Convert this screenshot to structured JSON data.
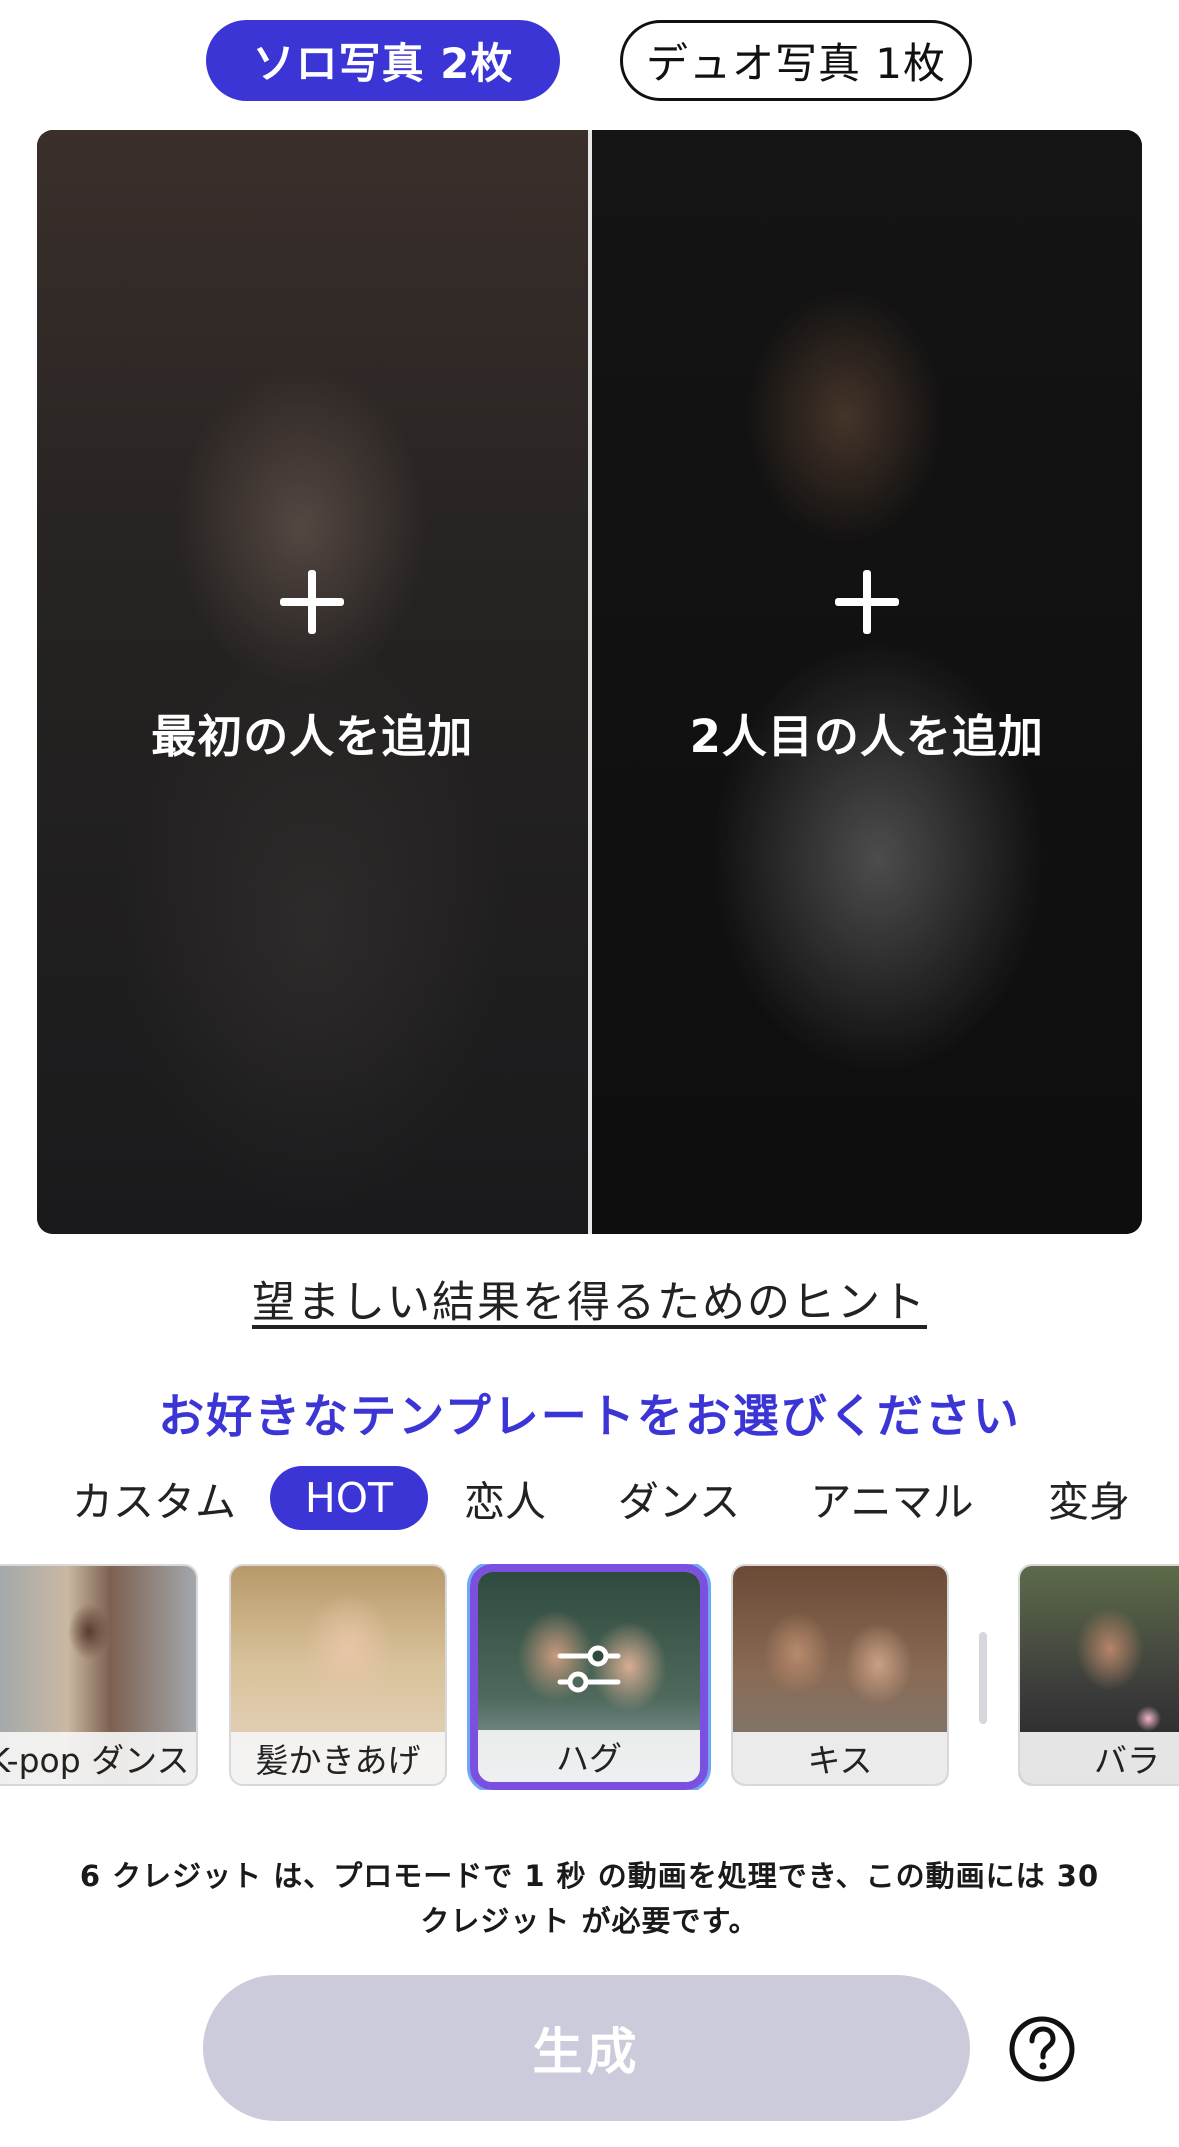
{
  "mode_toggle": {
    "solo_label": "ソロ写真 2枚",
    "duo_label": "デュオ写真 1枚",
    "active": "solo"
  },
  "photo_slots": {
    "first_label": "最初の人を追加",
    "second_label": "2人目の人を追加"
  },
  "hint_link": "望ましい結果を得るためのヒント",
  "section_title": "お好きなテンプレートをお選びください",
  "category_tabs": [
    {
      "label": "カスタム",
      "active": false
    },
    {
      "label": "HOT",
      "active": true
    },
    {
      "label": "恋人",
      "active": false
    },
    {
      "label": "ダンス",
      "active": false
    },
    {
      "label": "アニマル",
      "active": false
    },
    {
      "label": "変身",
      "active": false
    }
  ],
  "templates": [
    {
      "label": "K-pop ダンス",
      "selected": false
    },
    {
      "label": "髪かきあげ",
      "selected": false
    },
    {
      "label": "ハグ",
      "selected": true
    },
    {
      "label": "キス",
      "selected": false
    },
    {
      "label": "バラ",
      "selected": false
    }
  ],
  "credit_info": "6 クレジット は、プロモードで 1 秒 の動画を処理でき、この動画には 30 クレジット が必要です。",
  "generate_button": "生成",
  "icons": {
    "add": "plus-icon",
    "adjust": "sliders-icon",
    "help": "help-circle-icon"
  },
  "colors": {
    "accent": "#3b35d6",
    "selected_border": "#7b4fe0",
    "generate_disabled": "#cbcbdc"
  }
}
